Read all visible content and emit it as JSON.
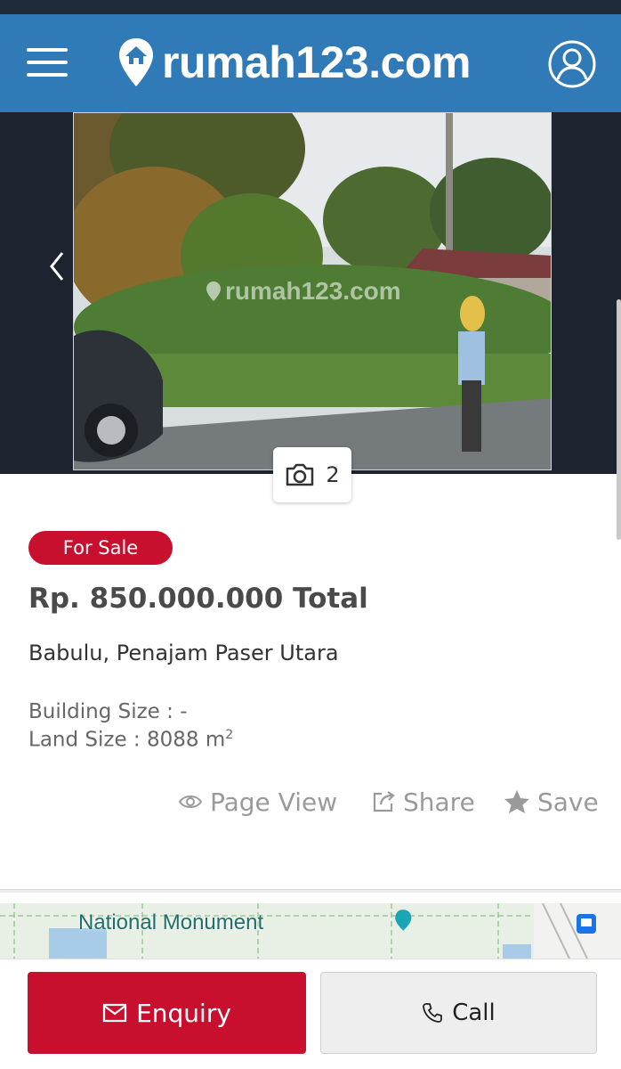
{
  "header": {
    "logo_text": "rumah123.com",
    "brand_color": "#2f7ab7"
  },
  "gallery": {
    "watermark": "rumah123.com",
    "photo_count": "2"
  },
  "listing": {
    "badge": "For Sale",
    "price": "Rp. 850.000.000 Total",
    "location": "Babulu, Penajam Paser Utara",
    "building_size": "Building Size : -",
    "land_size": "Land Size : 8088 m",
    "land_unit_sup": "2"
  },
  "actions": {
    "page_view": "Page View",
    "share": "Share",
    "save": "Save"
  },
  "map": {
    "label": "National Monument"
  },
  "footer": {
    "enquiry": "Enquiry",
    "call": "Call"
  },
  "icons": [
    "menu-icon",
    "home-pin-icon",
    "user-icon",
    "chevron-left-icon",
    "camera-icon",
    "eye-icon",
    "share-icon",
    "star-icon",
    "mail-icon",
    "phone-icon",
    "map-pin-icon",
    "bus-icon"
  ],
  "colors": {
    "accent_red": "#c8102e",
    "header_blue": "#2f7ab7",
    "gallery_bg": "#1d2430"
  }
}
